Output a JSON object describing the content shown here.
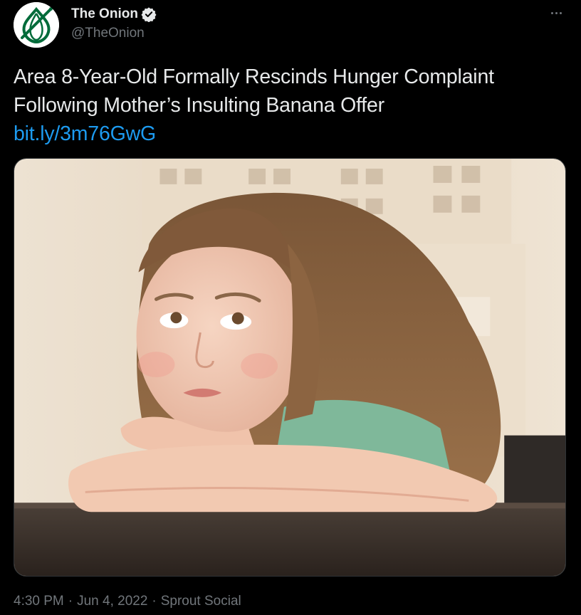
{
  "author": {
    "display_name": "The Onion",
    "handle": "@TheOnion",
    "verified": true,
    "avatar_icon": "onion-logo-icon"
  },
  "tweet": {
    "headline_line1": "Area 8-Year-Old Formally Rescinds Hunger Complaint",
    "headline_line2": "Following Mother’s Insulting Banana Offer",
    "link": "bit.ly/3m76GwG"
  },
  "media": {
    "description_icon": "photo-girl-resting-on-table"
  },
  "meta": {
    "time": "4:30 PM",
    "separator": "·",
    "date": "Jun 4, 2022",
    "source": "Sprout Social"
  },
  "colors": {
    "background": "#000000",
    "text_primary": "#e7e9ea",
    "text_secondary": "#71767b",
    "link": "#1d9bf0",
    "brand_green": "#006b3a"
  }
}
